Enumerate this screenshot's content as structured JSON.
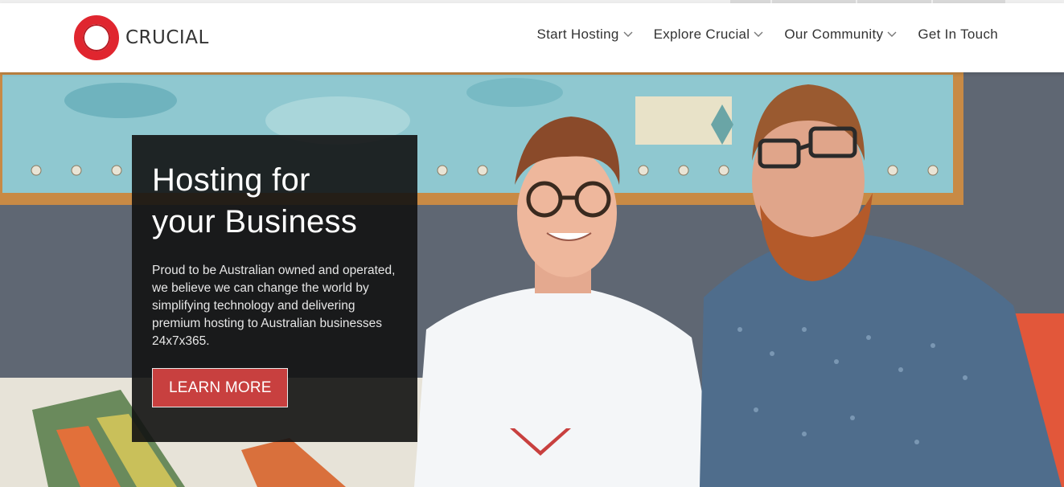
{
  "brand": {
    "name": "CRUCIAL",
    "accent_color": "#e0262f",
    "button_color": "#c8403f"
  },
  "nav": {
    "items": [
      {
        "label": "Start Hosting",
        "has_dropdown": true
      },
      {
        "label": "Explore Crucial",
        "has_dropdown": true
      },
      {
        "label": "Our Community",
        "has_dropdown": true
      },
      {
        "label": "Get In Touch",
        "has_dropdown": false
      }
    ],
    "chevron_icon": "chevron-down-icon"
  },
  "hero": {
    "title_line1": "Hosting for",
    "title_line2": "your Business",
    "description": "Proud to be Australian owned and operated, we believe we can change the world by simplifying technology and delivering premium hosting to Australian businesses 24x7x365.",
    "cta_label": "LEARN MORE",
    "scroll_icon": "chevron-down-icon"
  }
}
